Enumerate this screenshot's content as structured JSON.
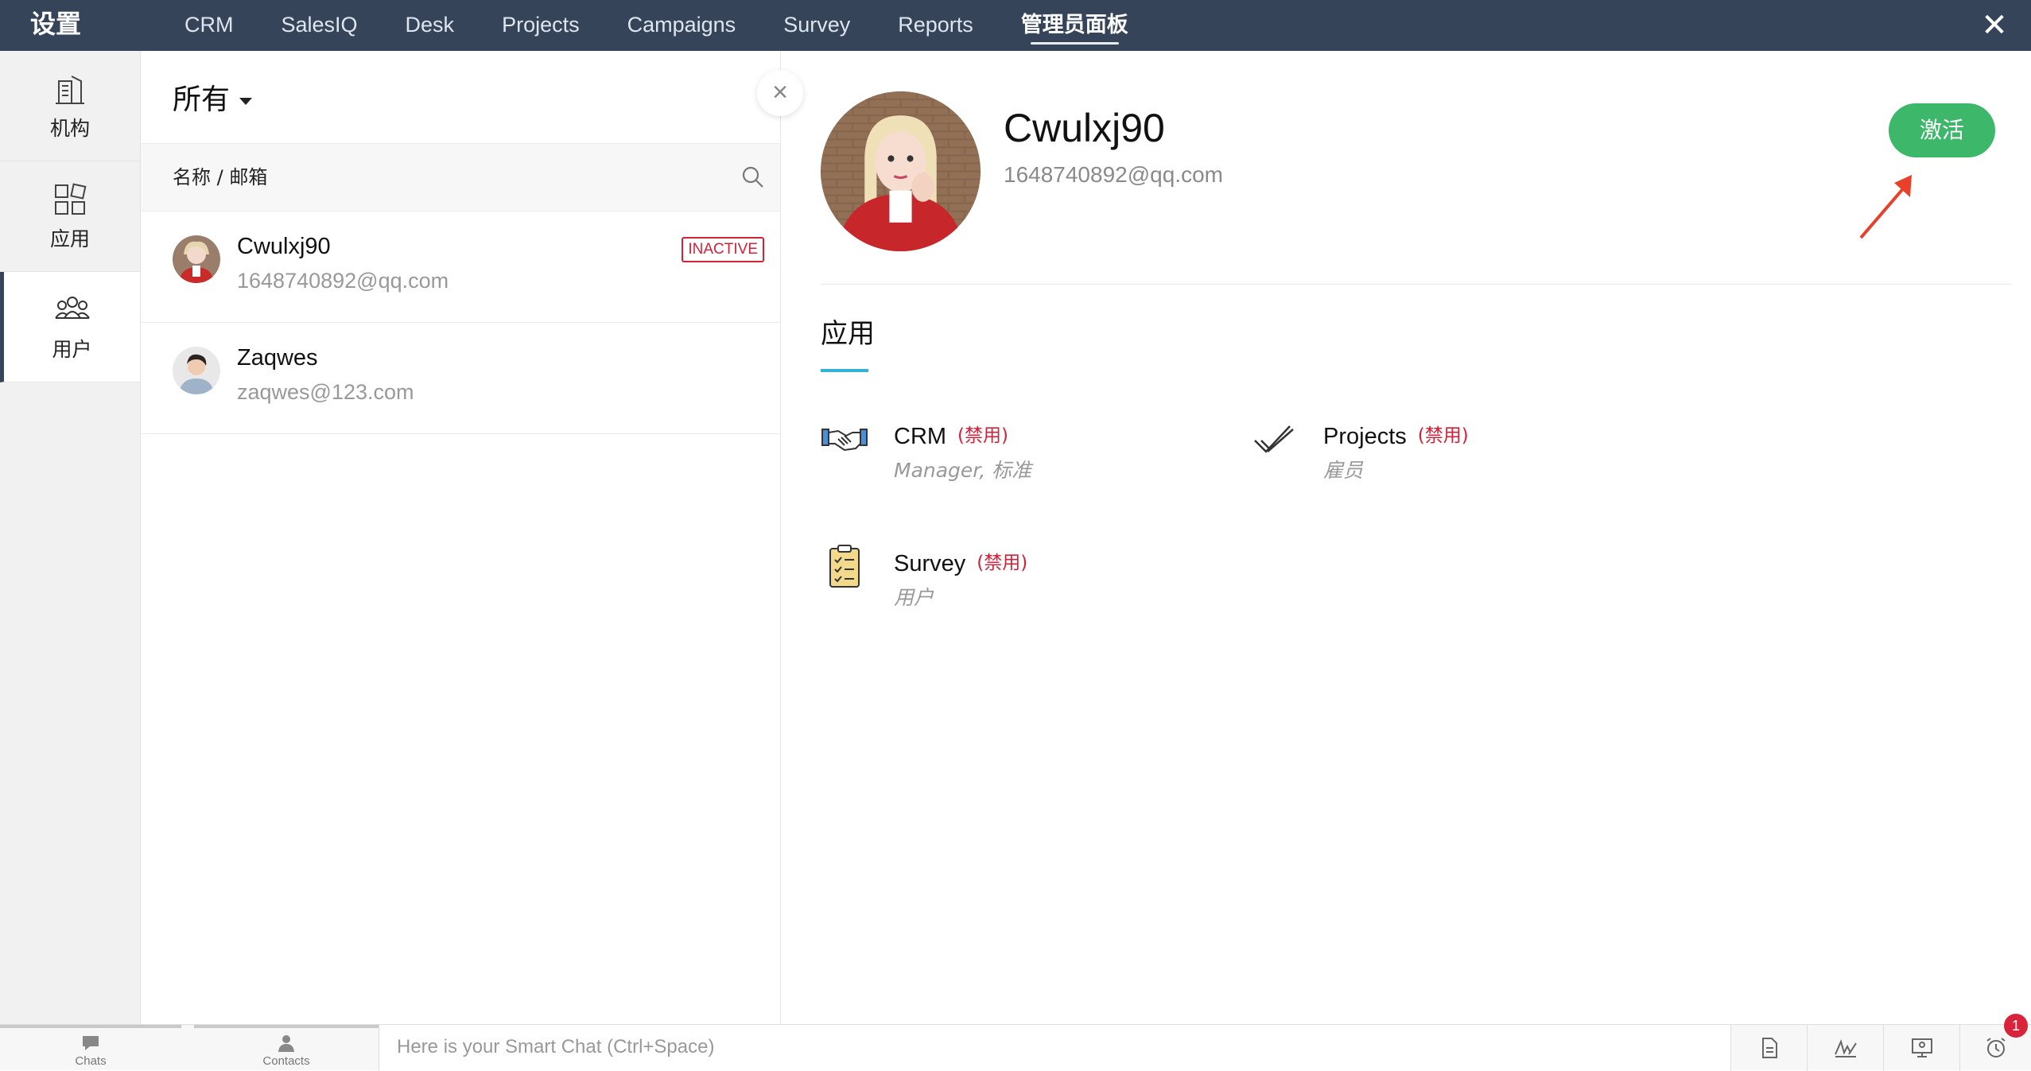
{
  "header": {
    "title": "设置",
    "nav": [
      "CRM",
      "SalesIQ",
      "Desk",
      "Projects",
      "Campaigns",
      "Survey",
      "Reports",
      "管理员面板"
    ],
    "active_nav": "管理员面板"
  },
  "rail": {
    "items": [
      {
        "label": "机构",
        "icon": "building-icon"
      },
      {
        "label": "应用",
        "icon": "apps-grid-icon"
      },
      {
        "label": "用户",
        "icon": "users-icon",
        "active": true
      }
    ]
  },
  "list": {
    "filter": "所有",
    "column_label": "名称 / 邮箱",
    "users": [
      {
        "name": "Cwulxj90",
        "email": "1648740892@qq.com",
        "badge": "INACTIVE"
      },
      {
        "name": "Zaqwes",
        "email": "zaqwes@123.com"
      }
    ]
  },
  "detail": {
    "name": "Cwulxj90",
    "email": "1648740892@qq.com",
    "activate_label": "激活",
    "section_title": "应用",
    "apps": [
      {
        "name": "CRM",
        "flag": "(禁用)",
        "role": "Manager, 标准",
        "icon": "handshake-icon"
      },
      {
        "name": "Projects",
        "flag": "(禁用)",
        "role": "雇员",
        "icon": "double-check-icon"
      },
      {
        "name": "Survey",
        "flag": "(禁用)",
        "role": "用户",
        "icon": "clipboard-checklist-icon"
      }
    ]
  },
  "bottom": {
    "chats": "Chats",
    "contacts": "Contacts",
    "smart_chat_placeholder": "Here is your Smart Chat (Ctrl+Space)",
    "notification_count": "1"
  },
  "colors": {
    "topbar": "#354459",
    "activate_green": "#3db76a",
    "inactive_red": "#d0233a",
    "accent_blue": "#35b3d6",
    "arrow_red": "#e8402a"
  }
}
